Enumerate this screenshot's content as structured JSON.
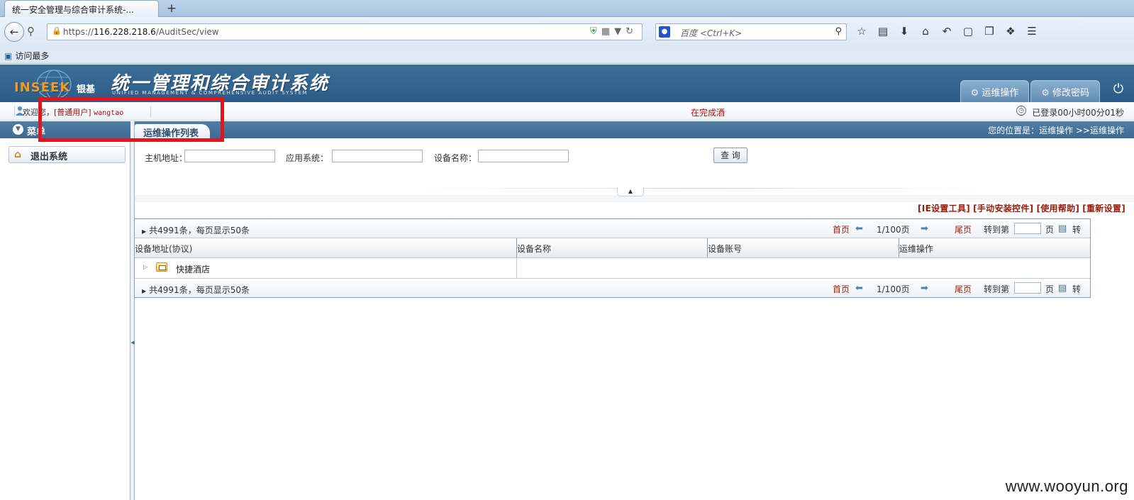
{
  "browser": {
    "tab_title": "统一安全管理与综合审计系统-...",
    "new_tab": "+",
    "url_prefix": "https://",
    "url_host": "116.228.218.6",
    "url_path": "/AuditSec/view",
    "search_placeholder": "百度 <Ctrl+K>",
    "bookmark": "访问最多"
  },
  "header": {
    "logo_text": "INSEEK",
    "logo_cn": "银基",
    "title": "统一管理和综合审计系统",
    "subtitle": "UNIFIED MANAGEMENT & COMPREHENSIVE AUDIT SYSTEM",
    "tabs": [
      {
        "label": "运维操作",
        "icon": "gear-icon"
      },
      {
        "label": "修改密码",
        "icon": "key-icon"
      }
    ]
  },
  "status": {
    "welcome": "欢迎您，",
    "user_type": "[普通用户]",
    "username": "wangtao",
    "hotel": "在完成酒",
    "login_time": "已登录00小时00分01秒"
  },
  "sidebar": {
    "title": "菜单",
    "items": [
      {
        "label": "退出系统",
        "icon": "home-icon"
      }
    ]
  },
  "main": {
    "tab": "运维操作列表",
    "breadcrumb": "您的位置是：运维操作 >>运维操作",
    "filters": {
      "host_label": "主机地址：",
      "app_label": "应用系统：",
      "device_label": "设备名称：",
      "query_button": "查 询"
    },
    "tool_links": [
      "[IE设置工具]",
      "[手动安装控件]",
      "[使用帮助]",
      "[重新设置]"
    ],
    "pager": {
      "total": "共4991条，每页显示50条",
      "first": "首页",
      "info": "1/100页",
      "last": "尾页",
      "goto": "转到第",
      "page_unit": "页",
      "go": "转"
    },
    "columns": [
      "设备地址(协议)",
      "设备名称",
      "设备账号",
      "运维操作"
    ],
    "rows": [
      {
        "name": "快捷酒店"
      }
    ]
  },
  "watermark": "www.wooyun.org",
  "colors": {
    "header_bg": "#2b5b86",
    "accent_red": "#e0161e",
    "link_red": "#9a1a08"
  }
}
